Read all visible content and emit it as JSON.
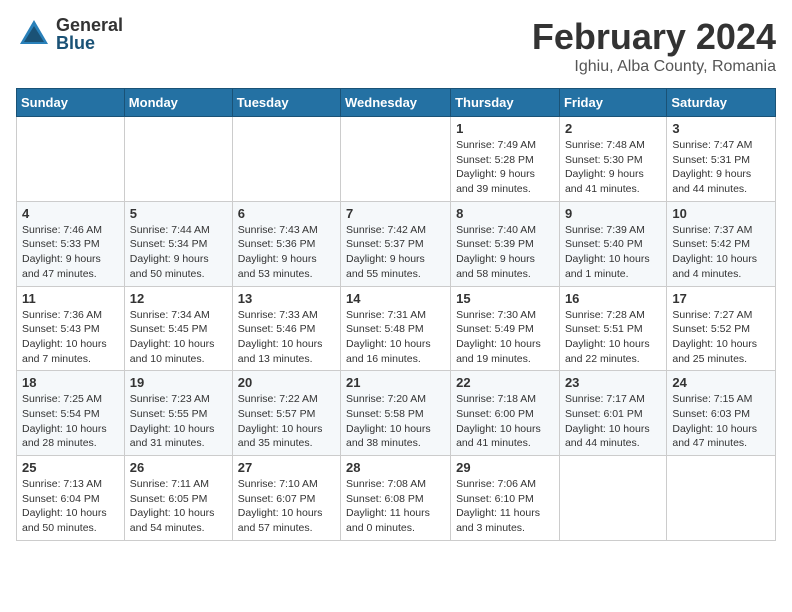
{
  "logo": {
    "general": "General",
    "blue": "Blue"
  },
  "title": "February 2024",
  "location": "Ighiu, Alba County, Romania",
  "days_of_week": [
    "Sunday",
    "Monday",
    "Tuesday",
    "Wednesday",
    "Thursday",
    "Friday",
    "Saturday"
  ],
  "weeks": [
    [
      {
        "day": "",
        "info": ""
      },
      {
        "day": "",
        "info": ""
      },
      {
        "day": "",
        "info": ""
      },
      {
        "day": "",
        "info": ""
      },
      {
        "day": "1",
        "info": "Sunrise: 7:49 AM\nSunset: 5:28 PM\nDaylight: 9 hours and 39 minutes."
      },
      {
        "day": "2",
        "info": "Sunrise: 7:48 AM\nSunset: 5:30 PM\nDaylight: 9 hours and 41 minutes."
      },
      {
        "day": "3",
        "info": "Sunrise: 7:47 AM\nSunset: 5:31 PM\nDaylight: 9 hours and 44 minutes."
      }
    ],
    [
      {
        "day": "4",
        "info": "Sunrise: 7:46 AM\nSunset: 5:33 PM\nDaylight: 9 hours and 47 minutes."
      },
      {
        "day": "5",
        "info": "Sunrise: 7:44 AM\nSunset: 5:34 PM\nDaylight: 9 hours and 50 minutes."
      },
      {
        "day": "6",
        "info": "Sunrise: 7:43 AM\nSunset: 5:36 PM\nDaylight: 9 hours and 53 minutes."
      },
      {
        "day": "7",
        "info": "Sunrise: 7:42 AM\nSunset: 5:37 PM\nDaylight: 9 hours and 55 minutes."
      },
      {
        "day": "8",
        "info": "Sunrise: 7:40 AM\nSunset: 5:39 PM\nDaylight: 9 hours and 58 minutes."
      },
      {
        "day": "9",
        "info": "Sunrise: 7:39 AM\nSunset: 5:40 PM\nDaylight: 10 hours and 1 minute."
      },
      {
        "day": "10",
        "info": "Sunrise: 7:37 AM\nSunset: 5:42 PM\nDaylight: 10 hours and 4 minutes."
      }
    ],
    [
      {
        "day": "11",
        "info": "Sunrise: 7:36 AM\nSunset: 5:43 PM\nDaylight: 10 hours and 7 minutes."
      },
      {
        "day": "12",
        "info": "Sunrise: 7:34 AM\nSunset: 5:45 PM\nDaylight: 10 hours and 10 minutes."
      },
      {
        "day": "13",
        "info": "Sunrise: 7:33 AM\nSunset: 5:46 PM\nDaylight: 10 hours and 13 minutes."
      },
      {
        "day": "14",
        "info": "Sunrise: 7:31 AM\nSunset: 5:48 PM\nDaylight: 10 hours and 16 minutes."
      },
      {
        "day": "15",
        "info": "Sunrise: 7:30 AM\nSunset: 5:49 PM\nDaylight: 10 hours and 19 minutes."
      },
      {
        "day": "16",
        "info": "Sunrise: 7:28 AM\nSunset: 5:51 PM\nDaylight: 10 hours and 22 minutes."
      },
      {
        "day": "17",
        "info": "Sunrise: 7:27 AM\nSunset: 5:52 PM\nDaylight: 10 hours and 25 minutes."
      }
    ],
    [
      {
        "day": "18",
        "info": "Sunrise: 7:25 AM\nSunset: 5:54 PM\nDaylight: 10 hours and 28 minutes."
      },
      {
        "day": "19",
        "info": "Sunrise: 7:23 AM\nSunset: 5:55 PM\nDaylight: 10 hours and 31 minutes."
      },
      {
        "day": "20",
        "info": "Sunrise: 7:22 AM\nSunset: 5:57 PM\nDaylight: 10 hours and 35 minutes."
      },
      {
        "day": "21",
        "info": "Sunrise: 7:20 AM\nSunset: 5:58 PM\nDaylight: 10 hours and 38 minutes."
      },
      {
        "day": "22",
        "info": "Sunrise: 7:18 AM\nSunset: 6:00 PM\nDaylight: 10 hours and 41 minutes."
      },
      {
        "day": "23",
        "info": "Sunrise: 7:17 AM\nSunset: 6:01 PM\nDaylight: 10 hours and 44 minutes."
      },
      {
        "day": "24",
        "info": "Sunrise: 7:15 AM\nSunset: 6:03 PM\nDaylight: 10 hours and 47 minutes."
      }
    ],
    [
      {
        "day": "25",
        "info": "Sunrise: 7:13 AM\nSunset: 6:04 PM\nDaylight: 10 hours and 50 minutes."
      },
      {
        "day": "26",
        "info": "Sunrise: 7:11 AM\nSunset: 6:05 PM\nDaylight: 10 hours and 54 minutes."
      },
      {
        "day": "27",
        "info": "Sunrise: 7:10 AM\nSunset: 6:07 PM\nDaylight: 10 hours and 57 minutes."
      },
      {
        "day": "28",
        "info": "Sunrise: 7:08 AM\nSunset: 6:08 PM\nDaylight: 11 hours and 0 minutes."
      },
      {
        "day": "29",
        "info": "Sunrise: 7:06 AM\nSunset: 6:10 PM\nDaylight: 11 hours and 3 minutes."
      },
      {
        "day": "",
        "info": ""
      },
      {
        "day": "",
        "info": ""
      }
    ]
  ]
}
